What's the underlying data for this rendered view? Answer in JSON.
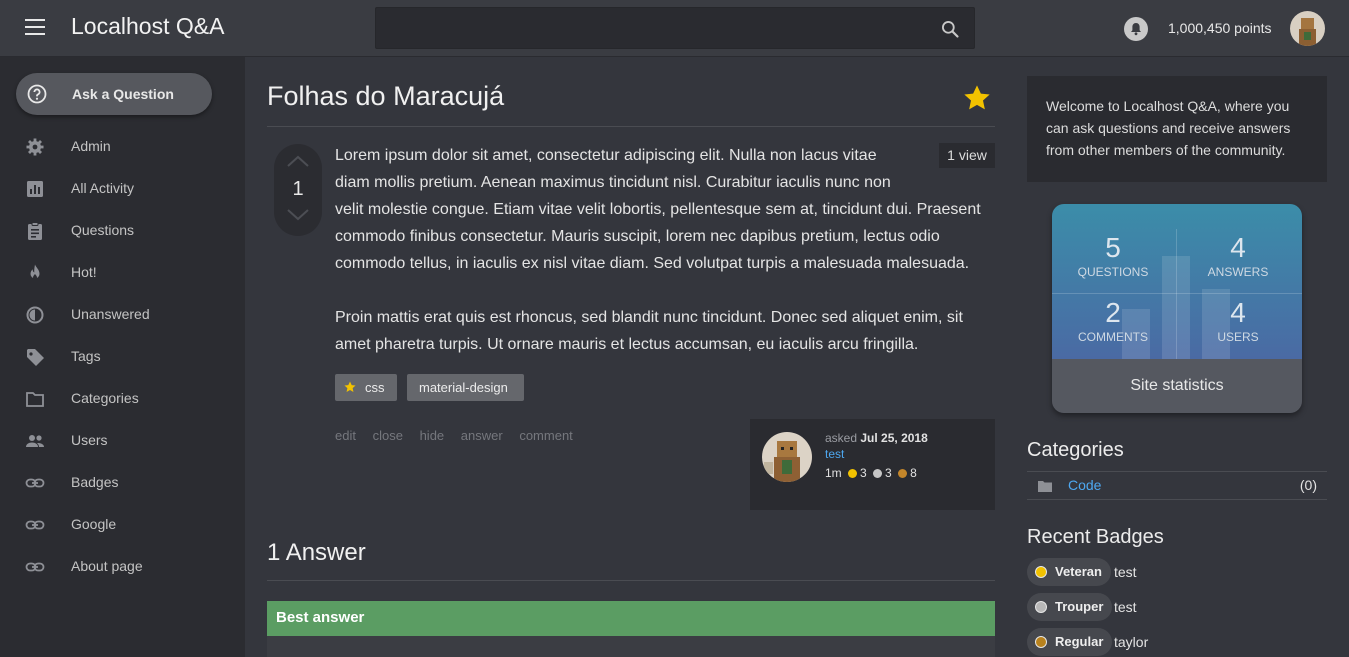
{
  "topbar": {
    "brand": "Localhost Q&A",
    "search_placeholder": "",
    "points": "1,000,450 points"
  },
  "sidebar": {
    "ask_label": "Ask a Question",
    "items": [
      {
        "label": "Admin",
        "icon": "gear-icon"
      },
      {
        "label": "All Activity",
        "icon": "chart-icon"
      },
      {
        "label": "Questions",
        "icon": "clipboard-icon"
      },
      {
        "label": "Hot!",
        "icon": "flame-icon"
      },
      {
        "label": "Unanswered",
        "icon": "half-circle-icon"
      },
      {
        "label": "Tags",
        "icon": "tag-icon"
      },
      {
        "label": "Categories",
        "icon": "folder-icon"
      },
      {
        "label": "Users",
        "icon": "users-icon"
      },
      {
        "label": "Badges",
        "icon": "link-icon"
      },
      {
        "label": "Google",
        "icon": "link-icon"
      },
      {
        "label": "About page",
        "icon": "link-icon"
      }
    ]
  },
  "question": {
    "title": "Folhas do Maracujá",
    "votes": "1",
    "views": "1 view",
    "paragraph1_lines": [
      "Lorem ipsum dolor sit amet, consectetur adipiscing elit. Nulla non lacus vitae",
      "diam mollis pretium. Aenean maximus tincidunt nisl. Curabitur iaculis nunc non",
      "velit molestie congue. Etiam vitae velit lobortis, pellentesque sem at, tincidunt dui. Praesent",
      "commodo finibus consectetur. Mauris suscipit, lorem nec dapibus pretium, lectus odio",
      "commodo tellus, in iaculis ex nisl vitae diam. Sed volutpat turpis a malesuada malesuada."
    ],
    "paragraph2_lines": [
      "Proin mattis erat quis est rhoncus, sed blandit nunc tincidunt. Donec sed aliquet enim, sit",
      "amet pharetra turpis. Ut ornare mauris et lectus accumsan, eu iaculis arcu fringilla."
    ],
    "tags": [
      "css",
      "material-design"
    ],
    "actions": [
      "edit",
      "close",
      "hide",
      "answer",
      "comment"
    ],
    "meta": {
      "asked_prefix": "asked",
      "asked_date": "Jul 25, 2018",
      "user": "test",
      "reputation": "1m",
      "gold": "3",
      "silver": "3",
      "bronze": "8"
    }
  },
  "answers": {
    "title": "1 Answer",
    "best_label": "Best answer"
  },
  "right": {
    "welcome": "Welcome to Localhost Q&A, where you can ask questions and receive answers from other members of the community.",
    "stats": {
      "questions_num": "5",
      "questions_lbl": "Questions",
      "answers_num": "4",
      "answers_lbl": "Answers",
      "comments_num": "2",
      "comments_lbl": "Comments",
      "users_num": "4",
      "users_lbl": "Users",
      "footer": "Site statistics"
    },
    "categories_title": "Categories",
    "categories": [
      {
        "name": "Code",
        "count": "(0)"
      }
    ],
    "badges_title": "Recent Badges",
    "badges": [
      {
        "name": "Veteran",
        "user": "test",
        "color": "#f2c200"
      },
      {
        "name": "Trouper",
        "user": "test",
        "color": "#b8b8b8"
      },
      {
        "name": "Regular",
        "user": "taylor",
        "color": "#b8821e"
      }
    ]
  },
  "colors": {
    "gold": "#f2c200",
    "silver": "#c6c6c6",
    "bronze": "#c4862a",
    "link": "#4ea8f0",
    "best_answer": "#5b9d63"
  }
}
